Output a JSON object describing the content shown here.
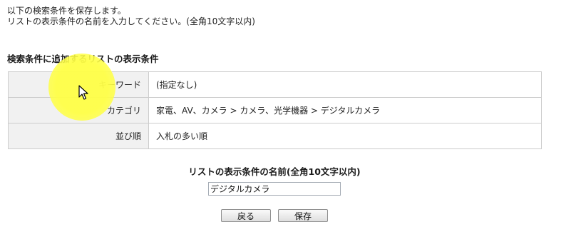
{
  "intro": {
    "line1": "以下の検索条件を保存します。",
    "line2": "リストの表示条件の名前を入力してください。(全角10文字以内)"
  },
  "conditions": {
    "title": "検索条件に追加するリストの表示条件",
    "rows": [
      {
        "label": "キーワード",
        "value": "(指定なし)"
      },
      {
        "label": "カテゴリ",
        "value": "家電、AV、カメラ > カメラ、光学機器 > デジタルカメラ"
      },
      {
        "label": "並び順",
        "value": "入札の多い順"
      }
    ]
  },
  "name_form": {
    "title": "リストの表示条件の名前(全角10文字以内)",
    "value": "デジタルカメラ"
  },
  "buttons": {
    "back": "戻る",
    "save": "保存"
  },
  "colors": {
    "label_bg": "#f1f1f1",
    "border": "#cccccc",
    "highlight": "#ffff46"
  }
}
